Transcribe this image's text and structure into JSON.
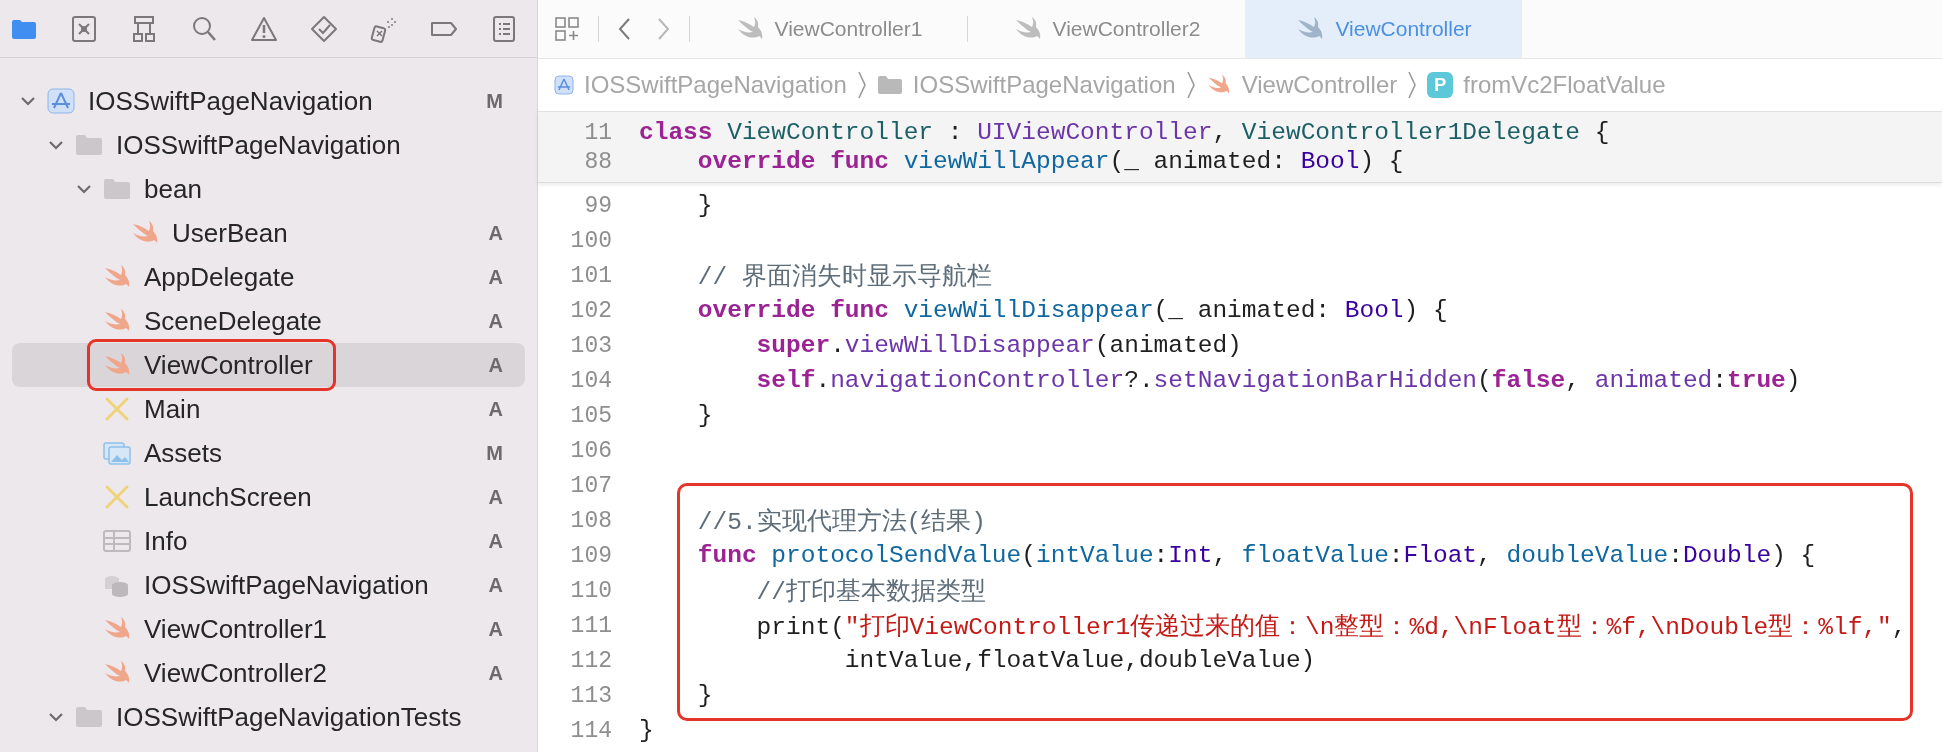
{
  "navigator": {
    "tabs": [
      {
        "selected": true
      },
      {
        "selected": false
      },
      {
        "selected": false
      },
      {
        "selected": false
      },
      {
        "selected": false
      },
      {
        "selected": false
      },
      {
        "selected": false
      },
      {
        "selected": false
      },
      {
        "selected": false
      }
    ],
    "items": [
      {
        "label": "IOSSwiftPageNavigation",
        "kind": "project",
        "badge": "M",
        "expanded": true,
        "selected": false,
        "boxed": false,
        "children": [
          {
            "label": "IOSSwiftPageNavigation",
            "kind": "folder",
            "expanded": true,
            "selected": false,
            "boxed": false,
            "children": [
              {
                "label": "bean",
                "kind": "folder",
                "expanded": true,
                "selected": false,
                "boxed": false,
                "children": [
                  {
                    "label": "UserBean",
                    "kind": "swift",
                    "badge": "A",
                    "selected": false,
                    "boxed": false
                  }
                ]
              },
              {
                "label": "AppDelegate",
                "kind": "swift",
                "badge": "A",
                "selected": false,
                "boxed": false
              },
              {
                "label": "SceneDelegate",
                "kind": "swift",
                "badge": "A",
                "selected": false,
                "boxed": false
              },
              {
                "label": "ViewController",
                "kind": "swift",
                "badge": "A",
                "selected": true,
                "boxed": true
              },
              {
                "label": "Main",
                "kind": "storyboard",
                "badge": "A",
                "selected": false,
                "boxed": false
              },
              {
                "label": "Assets",
                "kind": "assets",
                "badge": "M",
                "selected": false,
                "boxed": false
              },
              {
                "label": "LaunchScreen",
                "kind": "storyboard",
                "badge": "A",
                "selected": false,
                "boxed": false
              },
              {
                "label": "Info",
                "kind": "plist",
                "badge": "A",
                "selected": false,
                "boxed": false
              },
              {
                "label": "IOSSwiftPageNavigation",
                "kind": "datamodel",
                "badge": "A",
                "selected": false,
                "boxed": false
              },
              {
                "label": "ViewController1",
                "kind": "swift",
                "badge": "A",
                "selected": false,
                "boxed": false
              },
              {
                "label": "ViewController2",
                "kind": "swift",
                "badge": "A",
                "selected": false,
                "boxed": false
              }
            ]
          },
          {
            "label": "IOSSwiftPageNavigationTests",
            "kind": "folder",
            "expanded": true,
            "selected": false,
            "boxed": false
          }
        ]
      }
    ]
  },
  "editor": {
    "tabs": [
      {
        "label": "ViewController1",
        "selected": false
      },
      {
        "label": "ViewController2",
        "selected": false
      },
      {
        "label": "ViewController",
        "selected": true
      }
    ],
    "breadcrumb": [
      {
        "label": "IOSSwiftPageNavigation",
        "kind": "project"
      },
      {
        "label": "IOSSwiftPageNavigation",
        "kind": "folder"
      },
      {
        "label": "ViewController",
        "kind": "swift"
      },
      {
        "label": "fromVc2FloatValue",
        "kind": "property",
        "badge": "P"
      }
    ],
    "pinned_lines": [
      {
        "number": "11",
        "tokens": [
          {
            "text": "class ",
            "kind": "keyword"
          },
          {
            "text": "ViewController",
            "kind": "project_type"
          },
          {
            "text": " : ",
            "kind": "plain"
          },
          {
            "text": "UIViewController",
            "kind": "member"
          },
          {
            "text": ", ",
            "kind": "plain"
          },
          {
            "text": "ViewController1Delegate",
            "kind": "project_type"
          },
          {
            "text": " {",
            "kind": "plain"
          }
        ]
      },
      {
        "number": "88",
        "tokens": [
          {
            "text": "    override func ",
            "kind": "keyword"
          },
          {
            "text": "viewWillAppear",
            "kind": "declaration"
          },
          {
            "text": "(_ animated: ",
            "kind": "plain"
          },
          {
            "text": "Bool",
            "kind": "type"
          },
          {
            "text": ") {",
            "kind": "plain"
          }
        ]
      }
    ],
    "lines": [
      {
        "number": "99",
        "boxed": false,
        "tokens": [
          {
            "text": "    }",
            "kind": "plain"
          }
        ]
      },
      {
        "number": "100",
        "boxed": false
      },
      {
        "number": "101",
        "boxed": false,
        "tokens": [
          {
            "text": "    // 界面消失时显示导航栏",
            "kind": "comment"
          }
        ]
      },
      {
        "number": "102",
        "boxed": false,
        "tokens": [
          {
            "text": "    override func ",
            "kind": "keyword"
          },
          {
            "text": "viewWillDisappear",
            "kind": "declaration"
          },
          {
            "text": "(_ animated: ",
            "kind": "plain"
          },
          {
            "text": "Bool",
            "kind": "type"
          },
          {
            "text": ") {",
            "kind": "plain"
          }
        ]
      },
      {
        "number": "103",
        "boxed": false,
        "tokens": [
          {
            "text": "        super",
            "kind": "keyword"
          },
          {
            "text": ".",
            "kind": "plain"
          },
          {
            "text": "viewWillDisappear",
            "kind": "member"
          },
          {
            "text": "(animated)",
            "kind": "plain"
          }
        ]
      },
      {
        "number": "104",
        "boxed": false,
        "tokens": [
          {
            "text": "        self",
            "kind": "keyword"
          },
          {
            "text": ".",
            "kind": "plain"
          },
          {
            "text": "navigationController",
            "kind": "member"
          },
          {
            "text": "?.",
            "kind": "plain"
          },
          {
            "text": "setNavigationBarHidden",
            "kind": "member"
          },
          {
            "text": "(",
            "kind": "plain"
          },
          {
            "text": "false",
            "kind": "keyword"
          },
          {
            "text": ", ",
            "kind": "plain"
          },
          {
            "text": "animated",
            "kind": "member"
          },
          {
            "text": ":",
            "kind": "plain"
          },
          {
            "text": "true",
            "kind": "keyword"
          },
          {
            "text": ")",
            "kind": "plain"
          }
        ]
      },
      {
        "number": "105",
        "boxed": false,
        "tokens": [
          {
            "text": "    }",
            "kind": "plain"
          }
        ]
      },
      {
        "number": "106",
        "boxed": false
      },
      {
        "number": "107",
        "boxed": false
      },
      {
        "number": "108",
        "boxed": true,
        "tokens": [
          {
            "text": "    //5.实现代理方法(结果)",
            "kind": "comment"
          }
        ]
      },
      {
        "number": "109",
        "boxed": true,
        "tokens": [
          {
            "text": "    func ",
            "kind": "keyword"
          },
          {
            "text": "protocolSendValue",
            "kind": "declaration"
          },
          {
            "text": "(",
            "kind": "plain"
          },
          {
            "text": "intValue",
            "kind": "declaration"
          },
          {
            "text": ":",
            "kind": "plain"
          },
          {
            "text": "Int",
            "kind": "type"
          },
          {
            "text": ", ",
            "kind": "plain"
          },
          {
            "text": "floatValue",
            "kind": "declaration"
          },
          {
            "text": ":",
            "kind": "plain"
          },
          {
            "text": "Float",
            "kind": "type"
          },
          {
            "text": ", ",
            "kind": "plain"
          },
          {
            "text": "doubleValue",
            "kind": "declaration"
          },
          {
            "text": ":",
            "kind": "plain"
          },
          {
            "text": "Double",
            "kind": "type"
          },
          {
            "text": ") {",
            "kind": "plain"
          }
        ]
      },
      {
        "number": "110",
        "boxed": true,
        "tokens": [
          {
            "text": "        //打印基本数据类型",
            "kind": "comment"
          }
        ]
      },
      {
        "number": "111",
        "boxed": true,
        "tokens": [
          {
            "text": "        print(",
            "kind": "plain"
          },
          {
            "text": "\"打印ViewController1传递过来的值：\\n整型：%d,\\nFloat型：%f,\\nDouble型：%lf,\"",
            "kind": "string"
          },
          {
            "text": ",",
            "kind": "plain"
          }
        ]
      },
      {
        "number": "112",
        "boxed": true,
        "tokens": [
          {
            "text": "              intValue,floatValue,doubleValue)",
            "kind": "plain"
          }
        ]
      },
      {
        "number": "113",
        "boxed": true,
        "tokens": [
          {
            "text": "    }",
            "kind": "plain"
          }
        ]
      },
      {
        "number": "114",
        "boxed": false,
        "tokens": [
          {
            "text": "}",
            "kind": "plain"
          }
        ]
      }
    ]
  }
}
